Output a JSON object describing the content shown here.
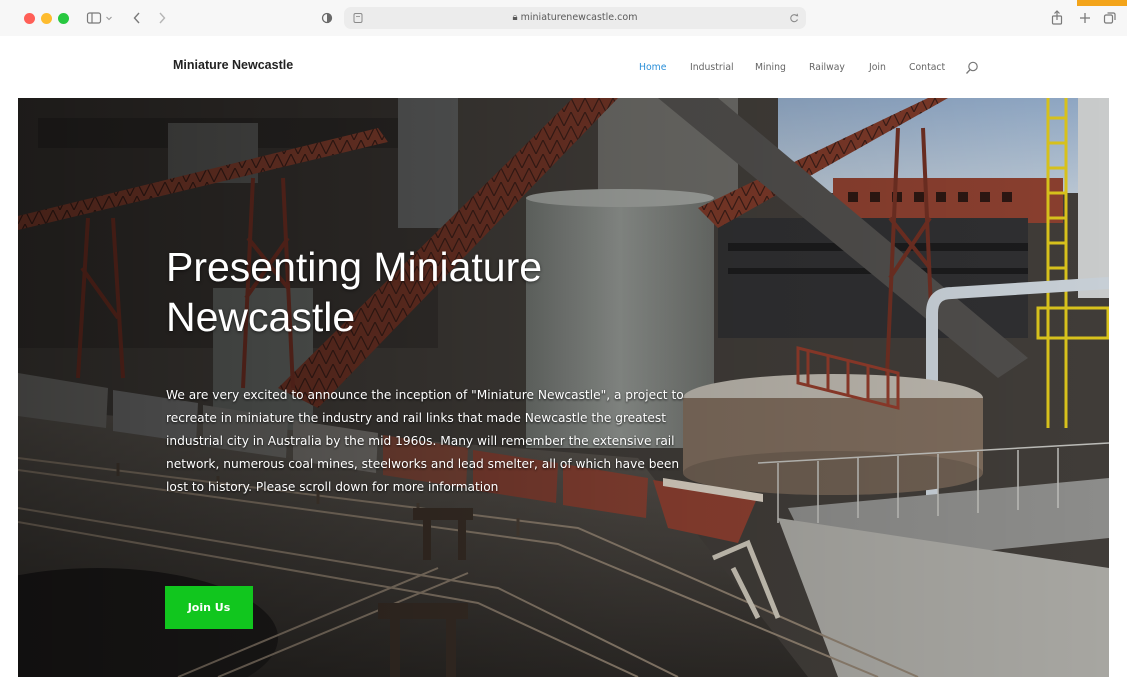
{
  "browser": {
    "url": "miniaturenewcastle.com"
  },
  "site": {
    "title": "Miniature Newcastle"
  },
  "nav": {
    "items": [
      {
        "label": "Home",
        "active": true
      },
      {
        "label": "Industrial",
        "active": false
      },
      {
        "label": "Mining",
        "active": false
      },
      {
        "label": "Railway",
        "active": false
      },
      {
        "label": "Join",
        "active": false
      },
      {
        "label": "Contact",
        "active": false
      }
    ],
    "search_icon": "search-icon"
  },
  "hero": {
    "title": "Presenting Miniature Newcastle",
    "intro": "We are very excited to announce the inception of \"Miniature Newcastle\", a project to recreate in miniature the industry and rail links that made Newcastle the greatest industrial city in Australia by the mid 1960s. Many will remember the extensive rail network, numerous coal mines, steelworks and lead smelter, all of which have been lost to history. Please scroll down for more information",
    "cta_label": "Join Us"
  },
  "colors": {
    "nav_active": "#2a8fd8",
    "cta_background": "#11c61e",
    "header_background": "#ffffff"
  }
}
